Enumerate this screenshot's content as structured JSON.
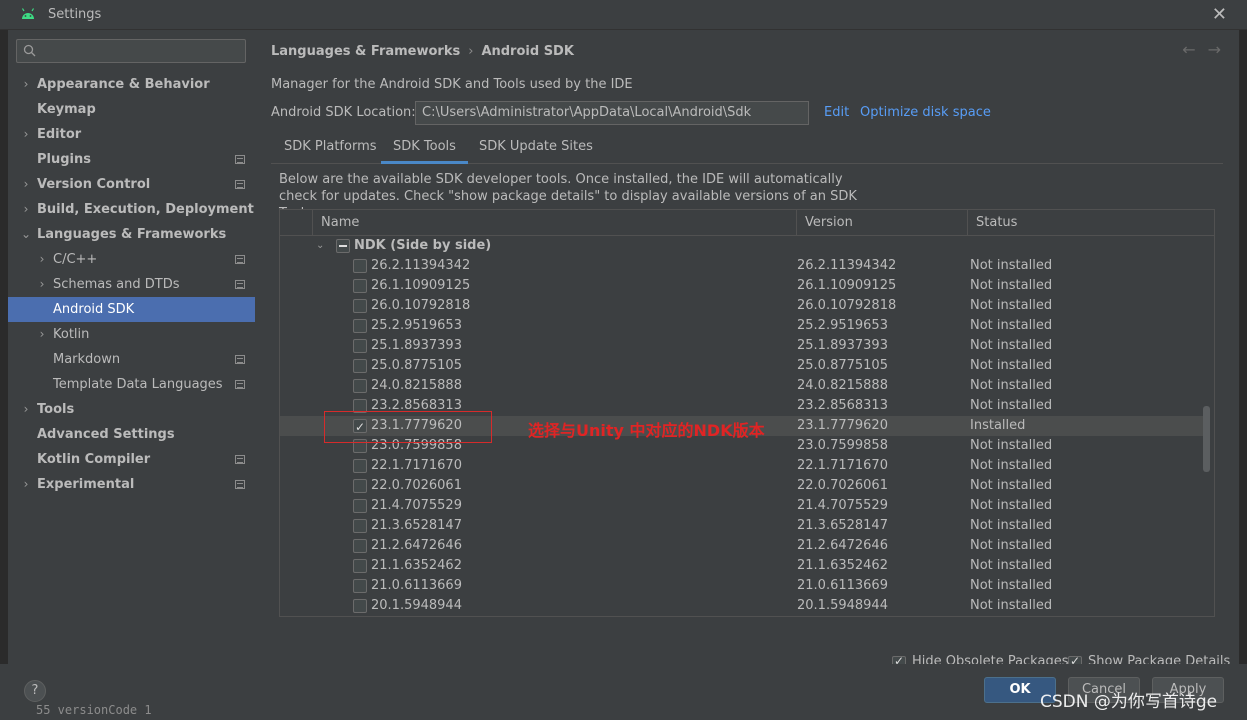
{
  "window": {
    "title": "Settings",
    "close_glyph": "✕"
  },
  "sidebar": {
    "search_placeholder": "",
    "items": [
      {
        "label": "Appearance & Behavior",
        "chevron": "›",
        "level": 0
      },
      {
        "label": "Keymap",
        "chevron": "",
        "level": 0
      },
      {
        "label": "Editor",
        "chevron": "›",
        "level": 0
      },
      {
        "label": "Plugins",
        "chevron": "",
        "level": 0,
        "project": true
      },
      {
        "label": "Version Control",
        "chevron": "›",
        "level": 0,
        "project": true
      },
      {
        "label": "Build, Execution, Deployment",
        "chevron": "›",
        "level": 0
      },
      {
        "label": "Languages & Frameworks",
        "chevron": "⌄",
        "level": 0
      },
      {
        "label": "C/C++",
        "chevron": "›",
        "level": 1,
        "project": true
      },
      {
        "label": "Schemas and DTDs",
        "chevron": "›",
        "level": 1,
        "project": true
      },
      {
        "label": "Android SDK",
        "chevron": "",
        "level": 1,
        "selected": true
      },
      {
        "label": "Kotlin",
        "chevron": "›",
        "level": 1
      },
      {
        "label": "Markdown",
        "chevron": "",
        "level": 1,
        "project": true
      },
      {
        "label": "Template Data Languages",
        "chevron": "",
        "level": 1,
        "project": true
      },
      {
        "label": "Tools",
        "chevron": "›",
        "level": 0
      },
      {
        "label": "Advanced Settings",
        "chevron": "",
        "level": 0
      },
      {
        "label": "Kotlin Compiler",
        "chevron": "",
        "level": 0,
        "project": true
      },
      {
        "label": "Experimental",
        "chevron": "›",
        "level": 0,
        "project": true
      }
    ]
  },
  "main": {
    "breadcrumb": {
      "parent": "Languages & Frameworks",
      "sep": "›",
      "current": "Android SDK"
    },
    "nav": {
      "back": "←",
      "forward": "→"
    },
    "description": "Manager for the Android SDK and Tools used by the IDE",
    "sdk_location_label": "Android SDK Location:",
    "sdk_location_value": "C:\\Users\\Administrator\\AppData\\Local\\Android\\Sdk",
    "edit_link": "Edit",
    "optimize_link": "Optimize disk space",
    "tabs": [
      "SDK Platforms",
      "SDK Tools",
      "SDK Update Sites"
    ],
    "active_tab": "SDK Tools",
    "sub_description": "Below are the available SDK developer tools. Once installed, the IDE will automatically check for updates. Check \"show package details\" to display available versions of an SDK Tool.",
    "table": {
      "columns": [
        "Name",
        "Version",
        "Status"
      ],
      "group": {
        "label": "NDK (Side by side)",
        "expanded_glyph": "⌄"
      },
      "rows": [
        {
          "name": "26.2.11394342",
          "version": "26.2.11394342",
          "status": "Not installed",
          "checked": false
        },
        {
          "name": "26.1.10909125",
          "version": "26.1.10909125",
          "status": "Not installed",
          "checked": false
        },
        {
          "name": "26.0.10792818",
          "version": "26.0.10792818",
          "status": "Not installed",
          "checked": false
        },
        {
          "name": "25.2.9519653",
          "version": "25.2.9519653",
          "status": "Not installed",
          "checked": false
        },
        {
          "name": "25.1.8937393",
          "version": "25.1.8937393",
          "status": "Not installed",
          "checked": false
        },
        {
          "name": "25.0.8775105",
          "version": "25.0.8775105",
          "status": "Not installed",
          "checked": false
        },
        {
          "name": "24.0.8215888",
          "version": "24.0.8215888",
          "status": "Not installed",
          "checked": false
        },
        {
          "name": "23.2.8568313",
          "version": "23.2.8568313",
          "status": "Not installed",
          "checked": false
        },
        {
          "name": "23.1.7779620",
          "version": "23.1.7779620",
          "status": "Installed",
          "checked": true
        },
        {
          "name": "23.0.7599858",
          "version": "23.0.7599858",
          "status": "Not installed",
          "checked": false
        },
        {
          "name": "22.1.7171670",
          "version": "22.1.7171670",
          "status": "Not installed",
          "checked": false
        },
        {
          "name": "22.0.7026061",
          "version": "22.0.7026061",
          "status": "Not installed",
          "checked": false
        },
        {
          "name": "21.4.7075529",
          "version": "21.4.7075529",
          "status": "Not installed",
          "checked": false
        },
        {
          "name": "21.3.6528147",
          "version": "21.3.6528147",
          "status": "Not installed",
          "checked": false
        },
        {
          "name": "21.2.6472646",
          "version": "21.2.6472646",
          "status": "Not installed",
          "checked": false
        },
        {
          "name": "21.1.6352462",
          "version": "21.1.6352462",
          "status": "Not installed",
          "checked": false
        },
        {
          "name": "21.0.6113669",
          "version": "21.0.6113669",
          "status": "Not installed",
          "checked": false
        },
        {
          "name": "20.1.5948944",
          "version": "20.1.5948944",
          "status": "Not installed",
          "checked": false
        }
      ]
    },
    "annotation": "选择与Unity 中对应的NDK版本",
    "options": {
      "hide_obsolete": "Hide Obsolete Packages",
      "show_details": "Show Package Details"
    }
  },
  "footer": {
    "help": "?",
    "ok": "OK",
    "cancel": "Cancel",
    "apply": "Apply"
  },
  "watermark": "CSDN @为你写首诗ge",
  "editor_peek": "55    versionCode 1",
  "colors": {
    "accent": "#4b6eaf",
    "link": "#589df6",
    "annotation": "#e02424",
    "primary_button": "#365880"
  }
}
